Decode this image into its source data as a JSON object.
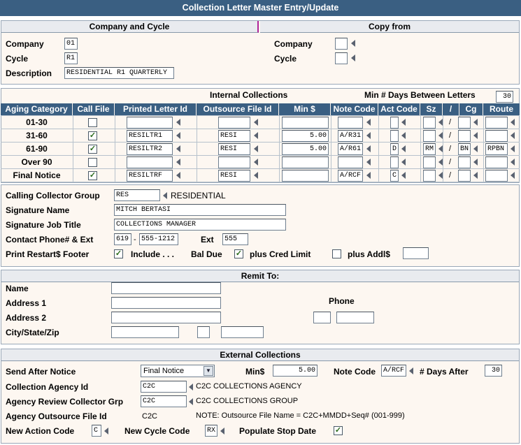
{
  "title": "Collection Letter Master Entry/Update",
  "company_cycle": {
    "header": "Company and Cycle",
    "company_label": "Company",
    "company_value": "01",
    "cycle_label": "Cycle",
    "cycle_value": "R1",
    "description_label": "Description",
    "description_value": "RESIDENTIAL R1 QUARTERLY"
  },
  "copy_from": {
    "header": "Copy from",
    "company_label": "Company",
    "company_value": "",
    "cycle_label": "Cycle",
    "cycle_value": ""
  },
  "internal": {
    "header": "Internal Collections",
    "min_days_label": "Min # Days Between Letters",
    "min_days_value": "30",
    "columns": [
      "Aging Category",
      "Call File",
      "Printed Letter Id",
      "Outsource File Id",
      "Min $",
      "Note Code",
      "Act Code",
      "Sz",
      "/",
      "Cg",
      "Route"
    ],
    "rows": [
      {
        "category": "01-30",
        "call_file": "",
        "letter_id": "",
        "outsource_id": "",
        "min": "",
        "note_code": "",
        "act_code": "",
        "sz": "",
        "slash": "/",
        "cg": "",
        "route": ""
      },
      {
        "category": "31-60",
        "call_file": "✓",
        "letter_id": "RESILTR1",
        "outsource_id": "RESI",
        "min": "5.00",
        "note_code": "A/R31",
        "act_code": "",
        "sz": "",
        "slash": "/",
        "cg": "",
        "route": ""
      },
      {
        "category": "61-90",
        "call_file": "✓",
        "letter_id": "RESILTR2",
        "outsource_id": "RESI",
        "min": "5.00",
        "note_code": "A/R61",
        "act_code": "D",
        "sz": "RM",
        "slash": "/",
        "cg": "BN",
        "route": "RPBN"
      },
      {
        "category": "Over 90",
        "call_file": "",
        "letter_id": "",
        "outsource_id": "",
        "min": "",
        "note_code": "",
        "act_code": "",
        "sz": "",
        "slash": "/",
        "cg": "",
        "route": ""
      },
      {
        "category": "Final Notice",
        "call_file": "✓",
        "letter_id": "RESILTRF",
        "outsource_id": "RESI",
        "min": "",
        "note_code": "A/RCF",
        "act_code": "C",
        "sz": "",
        "slash": "/",
        "cg": "",
        "route": ""
      }
    ]
  },
  "calling": {
    "group_label": "Calling Collector Group",
    "group_value": "RES",
    "group_desc": "RESIDENTIAL",
    "sig_name_label": "Signature Name",
    "sig_name_value": "MITCH BERTASI",
    "sig_title_label": "Signature Job Title",
    "sig_title_value": "COLLECTIONS MANAGER",
    "phone_label": "Contact Phone# & Ext",
    "phone_area": "619",
    "phone_dash": "-",
    "phone_num": "555-1212",
    "ext_label": "Ext",
    "ext_value": "555",
    "footer_label": "Print Restart$ Footer",
    "footer_checked": "✓",
    "include_label": "Include . . .",
    "bal_due_label": "Bal Due",
    "cred_limit_checked": "✓",
    "cred_limit_label": "plus Cred Limit",
    "addl_checked": "",
    "addl_label": "plus Addl$",
    "addl_value": ""
  },
  "remit": {
    "header": "Remit To:",
    "name_label": "Name",
    "addr1_label": "Address 1",
    "addr2_label": "Address 2",
    "csz_label": "City/State/Zip",
    "phone_label": "Phone",
    "name_value": "",
    "addr1_value": "",
    "addr2_value": "",
    "city_value": "",
    "state_value": "",
    "zip_value": "",
    "phone_area": "",
    "phone_num": ""
  },
  "external": {
    "header": "External Collections",
    "send_after_label": "Send After Notice",
    "send_after_value": "Final Notice",
    "min_label": "Min$",
    "min_value": "5.00",
    "note_code_label": "Note Code",
    "note_code_value": "A/RCF",
    "days_after_label": "# Days After",
    "days_after_value": "30",
    "agency_label": "Collection Agency Id",
    "agency_value": "C2C",
    "agency_desc": "C2C COLLECTIONS AGENCY",
    "review_label": "Agency Review Collector Grp",
    "review_value": "C2C",
    "review_desc": "C2C COLLECTIONS GROUP",
    "outsource_label": "Agency Outsource File Id",
    "outsource_value": "C2C",
    "outsource_note": "NOTE: Outsource File Name = C2C+MMDD+Seq# (001-999)",
    "action_label": "New Action Code",
    "action_value": "C",
    "cycle_label": "New Cycle Code",
    "cycle_value": "RX",
    "stop_label": "Populate Stop Date",
    "stop_checked": "✓"
  }
}
